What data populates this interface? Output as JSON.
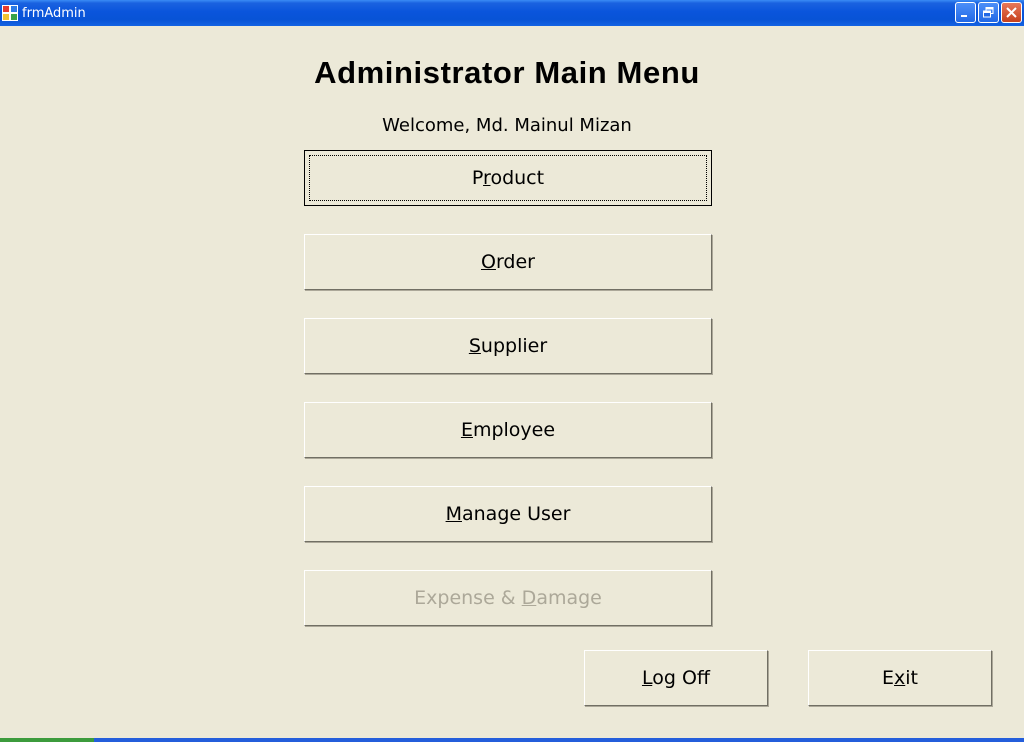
{
  "window": {
    "title": "frmAdmin",
    "icons": {
      "app": "app-icon",
      "minimize": "minimize-icon",
      "restore": "restore-icon",
      "close": "close-icon"
    },
    "colors": {
      "titlebar": "#0853d6",
      "background": "#ece9d8",
      "disabled_text": "#aca899"
    }
  },
  "header": {
    "title": "Administrator Main Menu",
    "welcome": "Welcome, Md. Mainul Mizan"
  },
  "menu": {
    "product": {
      "pre": "P",
      "key": "r",
      "post": "oduct"
    },
    "order": {
      "pre": "",
      "key": "O",
      "post": "rder"
    },
    "supplier": {
      "pre": "",
      "key": "S",
      "post": "upplier"
    },
    "employee": {
      "pre": "",
      "key": "E",
      "post": "mployee"
    },
    "manage_user": {
      "pre": "",
      "key": "M",
      "post": "anage User"
    },
    "expense": {
      "pre": "Expense & ",
      "key": "D",
      "post": "amage",
      "enabled": false
    }
  },
  "footer": {
    "logoff": {
      "pre": "",
      "key": "L",
      "post": "og Off"
    },
    "exit": {
      "pre": "E",
      "key": "x",
      "post": "it"
    }
  }
}
